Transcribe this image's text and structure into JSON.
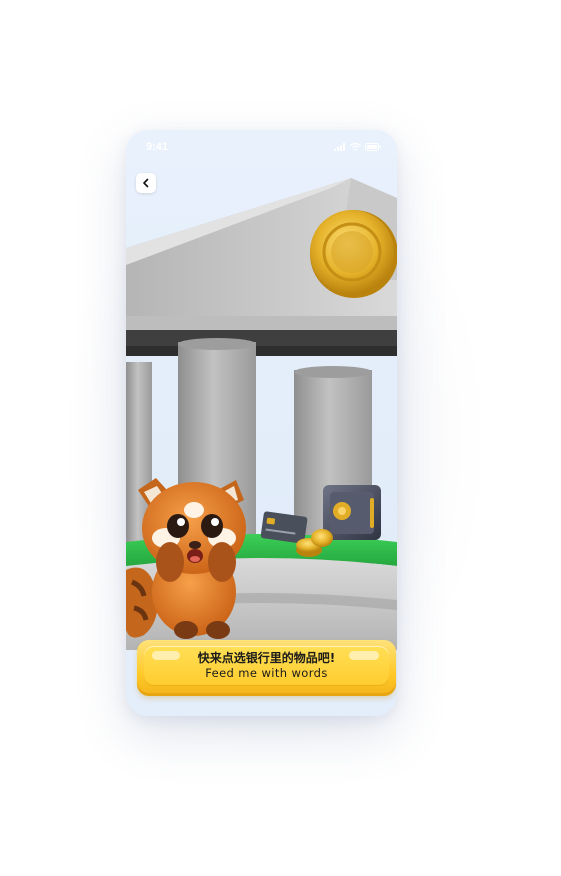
{
  "status_bar": {
    "time": "9:41",
    "icons": [
      "signal-icon",
      "wifi-icon",
      "battery-icon"
    ]
  },
  "nav": {
    "back_icon": "chevron-left-icon"
  },
  "scene": {
    "illustration": [
      "bank-building",
      "gold-coin",
      "red-panda-mascot",
      "safe",
      "credit-card",
      "coin-stack"
    ]
  },
  "cta": {
    "title": "快来点选银行里的物品吧!",
    "subtitle": "Feed me with words"
  },
  "colors": {
    "background": "#e4eefb",
    "cta_yellow": "#ffcc2e",
    "building_gray": "#a9a9a9",
    "grass_green": "#2fb84a",
    "coin_gold": "#e2ad26",
    "panda_orange": "#e07a22"
  }
}
